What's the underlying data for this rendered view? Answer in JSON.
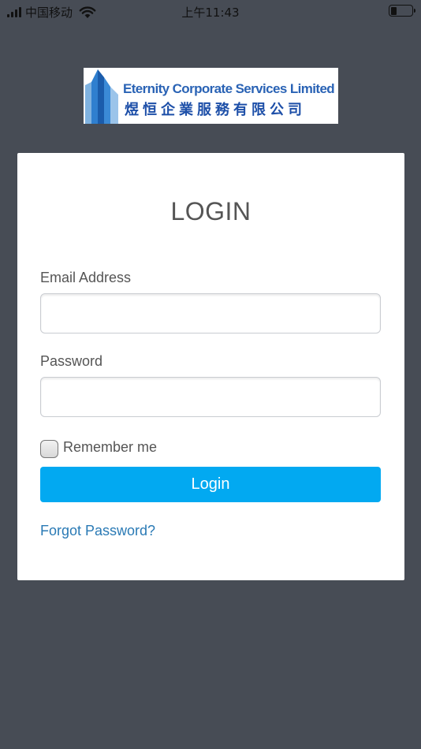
{
  "status_bar": {
    "carrier": "中国移动",
    "time": "上午11:43",
    "battery_level": 0.3
  },
  "logo": {
    "name_en": "Eternity Corporate Services Limited",
    "name_zh": "煜恒企業服務有限公司"
  },
  "login": {
    "title": "LOGIN",
    "email_label": "Email Address",
    "email_value": "",
    "password_label": "Password",
    "password_value": "",
    "remember_label": "Remember me",
    "remember_checked": false,
    "submit_label": "Login",
    "forgot_label": "Forgot Password?"
  },
  "colors": {
    "background": "#474c55",
    "accent": "#02a9f1",
    "link": "#2a7ab5"
  }
}
